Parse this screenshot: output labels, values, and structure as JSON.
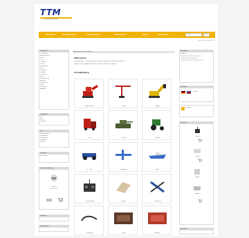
{
  "header": {
    "logo_text": "TTM",
    "logo_tagline": "www.ttm-modellbau.de"
  },
  "nav": {
    "items": [
      "Startseite",
      "Produktsuche",
      "Kundenkonto",
      "Warenkorb",
      "Kasse",
      "Impressum"
    ],
    "search_placeholder": "Suche",
    "search_button": "go"
  },
  "subbar": "Konto | Warenkorb | Kasse",
  "left": {
    "categories_title": "Kategorien",
    "categories": [
      "RC Modelle",
      "Baumaschinen",
      "Kräne",
      "LKW",
      "Traktoren",
      "Panzer",
      "Flugmodelle",
      "Boote",
      "Ersatzteile",
      "Zubehör",
      "Werkzeug",
      "Akkus",
      "Fernsteuerung",
      "Antriebe",
      "Karosserien",
      "Räder",
      "Sonstiges",
      "Angebote"
    ],
    "news_title": "Neuigkeiten",
    "news_lines": [
      "Alle",
      "Artikel",
      "anzeigen"
    ],
    "info_title": "Info",
    "info_lines": [
      "Versandkosten",
      "Privatsphäre",
      "Unsere AGB",
      "Impressum",
      "Kontakt"
    ],
    "box4_title": "Hersteller",
    "box4_lines": [
      "Bitte wählen"
    ],
    "featured_title": "Unsere Empfehlung",
    "featured_lines": [
      "Artikel",
      "EUR 19,95"
    ],
    "box6_title": "Newsletter",
    "box7_title": "Bewertungen"
  },
  "main": {
    "breadcrumb": "Willkommen in unserem Shop",
    "heading": "Willkommen",
    "text_lines": [
      "Willkommen bei TTM Modellbau. Hier finden Sie Modelle, Zubehör und Ersatzteile.",
      "Nutzen Sie die Kategorien links oder die Suche, um Artikel zu finden."
    ],
    "categories_heading": "Produktkatalog",
    "cards": [
      {
        "label": "Baumaschinen",
        "icon": "excavator-red-icon"
      },
      {
        "label": "Kräne",
        "icon": "crane-red-icon"
      },
      {
        "label": "Bagger",
        "icon": "digger-yellow-icon"
      },
      {
        "label": "LKW",
        "icon": "truck-red-icon"
      },
      {
        "label": "Panzer",
        "icon": "tank-icon"
      },
      {
        "label": "Traktoren",
        "icon": "tractor-green-icon"
      },
      {
        "label": "RC Cars",
        "icon": "rc-car-blue-icon"
      },
      {
        "label": "Flugmodelle",
        "icon": "plane-icon"
      },
      {
        "label": "Boote",
        "icon": "boat-icon"
      },
      {
        "label": "Fernsteuerung",
        "icon": "remote-icon"
      },
      {
        "label": "Zubehör",
        "icon": "accessory-icon"
      },
      {
        "label": "Werkzeug",
        "icon": "tools-icon"
      },
      {
        "label": "Ersatzteile",
        "icon": "spare-parts-icon"
      },
      {
        "label": "Videos",
        "icon": "video-icon"
      },
      {
        "label": "Aktionen",
        "icon": "promo-icon"
      }
    ]
  },
  "right": {
    "cart_title": "Warenkorb",
    "cart_lines": [
      "0 Artikel"
    ],
    "lang_title": "Sprachen",
    "lang_lines": [
      "Deutsch",
      "English"
    ],
    "bestseller_title": "Bestseller",
    "bestseller_lines": [
      "Artikel 1",
      "Artikel 2",
      "Artikel 3",
      "Artikel 4"
    ],
    "login_title": "Anmelden",
    "login_lines": [
      "E-Mail",
      "Passwort"
    ]
  },
  "colors": {
    "brand_blue": "#1a2f8c",
    "brand_yellow": "#f2b200",
    "header_gray": "#dadada"
  }
}
